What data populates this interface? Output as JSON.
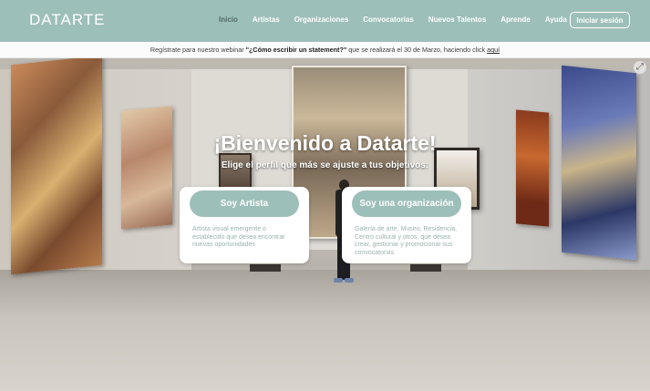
{
  "header": {
    "logo": "DATARTE",
    "nav": [
      "Inicio",
      "Artistas",
      "Organizaciones",
      "Convocatorias",
      "Nuevos Talentos",
      "Aprende",
      "Ayuda"
    ],
    "login_label": "Iniciar sesión"
  },
  "announcement": {
    "prefix": "Regístrate para nuestro webinar ",
    "highlight": "\"¿Cómo escribir un statement?\"",
    "middle": " que se realizará el 30 de Marzo, haciendo click ",
    "link": "aquí"
  },
  "hero": {
    "title": "¡Bienvenido a Datarte!",
    "subtitle": "Elige el perfil que más se ajuste a tus objetivos:"
  },
  "cards": [
    {
      "button": "Soy Artista",
      "description": "Artista visual emergente o establecido que desea encontrar nuevas oportunidades"
    },
    {
      "button": "Soy una organización",
      "description": "Galería de arte, Museo, Residencia, Centro cultural y otros, que desea crear, gestionar y promocionar sus convocatorias"
    }
  ],
  "colors": {
    "brand": "#9dbfb9",
    "nav_active": "#4e6a66",
    "card_text": "#9ab3ae"
  },
  "icons": {
    "zoom": "expand-icon"
  }
}
